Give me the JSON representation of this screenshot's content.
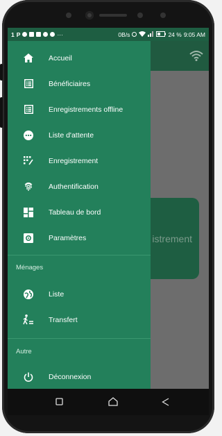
{
  "status_bar": {
    "left_icons": [
      "1",
      "P"
    ],
    "network": "0B/s",
    "battery": "24 %",
    "time": "9:05 AM"
  },
  "drawer": {
    "items": [
      {
        "label": "Accueil",
        "icon": "home-icon"
      },
      {
        "label": "Bénéficiaires",
        "icon": "list-box-icon"
      },
      {
        "label": "Enregistrements offline",
        "icon": "list-box-icon"
      },
      {
        "label": "Liste d'attente",
        "icon": "more-horizontal-circle-icon"
      },
      {
        "label": "Enregistrement",
        "icon": "keypad-icon"
      },
      {
        "label": "Authentification",
        "icon": "fingerprint-icon"
      },
      {
        "label": "Tableau de bord",
        "icon": "dashboard-icon"
      },
      {
        "label": "Paramètres",
        "icon": "settings-box-icon"
      }
    ],
    "sections": {
      "menages": {
        "title": "Ménages",
        "items": [
          {
            "label": "Liste",
            "icon": "globe-icon"
          },
          {
            "label": "Transfert",
            "icon": "person-transfer-icon"
          }
        ]
      },
      "autre": {
        "title": "Autre",
        "items": [
          {
            "label": "Déconnexion",
            "icon": "power-icon"
          }
        ]
      }
    }
  },
  "background": {
    "card_text": "istrement"
  },
  "colors": {
    "drawer": "#23805b",
    "appbar": "#205a40",
    "scrim": "#6d6d6d"
  }
}
